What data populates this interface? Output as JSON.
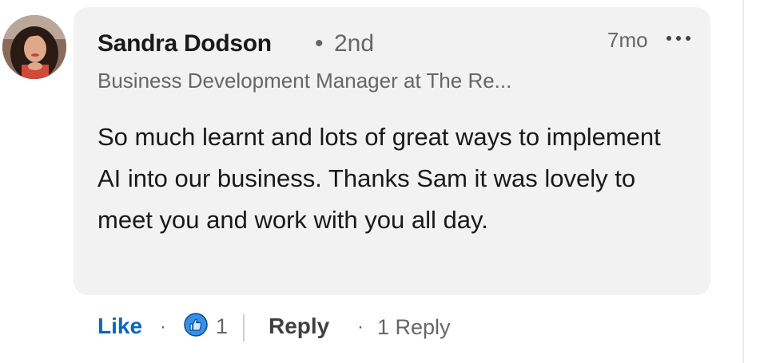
{
  "comment": {
    "author": {
      "name": "Sandra Dodson",
      "degree_separator": "•",
      "degree": "2nd",
      "headline": "Business Development Manager at The Re..."
    },
    "time": "7mo",
    "more_icon": "ellipsis-icon",
    "text": "So much learnt and lots of great ways to implement AI into our business. Thanks Sam it was lovely to meet you and work with you all day."
  },
  "actions": {
    "like_label": "Like",
    "separator": "·",
    "reaction_icon": "thumbs-up-icon",
    "reaction_count": "1",
    "reply_label": "Reply",
    "replies_label": "1 Reply"
  },
  "colors": {
    "like_blue": "#0a66c2",
    "bubble_bg": "#f2f2f2",
    "muted_text": "#666666"
  }
}
